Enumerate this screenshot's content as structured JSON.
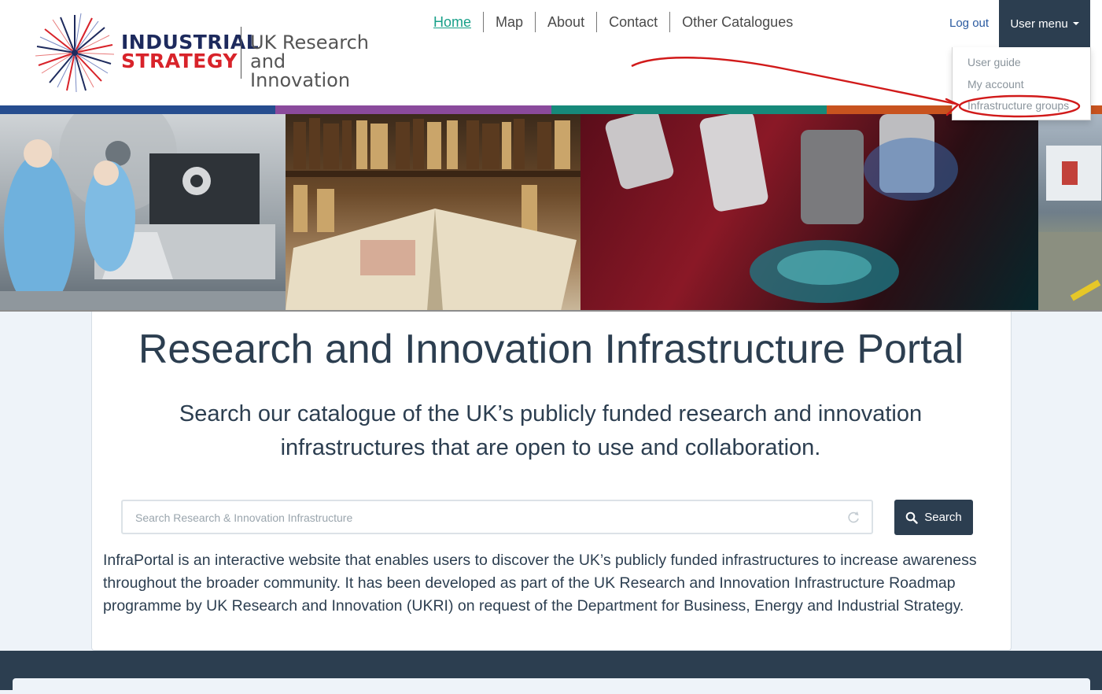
{
  "logo": {
    "line1": "INDUSTRIAL",
    "line2": "STRATEGY",
    "ukri_line1": "UK Research",
    "ukri_line2": "and Innovation"
  },
  "nav": {
    "items": [
      {
        "label": "Home"
      },
      {
        "label": "Map"
      },
      {
        "label": "About"
      },
      {
        "label": "Contact"
      },
      {
        "label": "Other Catalogues"
      }
    ],
    "logout_label": "Log out",
    "user_menu_label": "User menu"
  },
  "dropdown": {
    "items": [
      {
        "label": "User guide"
      },
      {
        "label": "My account"
      },
      {
        "label": "Infrastructure groups"
      }
    ]
  },
  "stripe_colors": [
    "#264d8f",
    "#8a4a9c",
    "#16897a",
    "#c8531f"
  ],
  "main": {
    "title": "Research and Innovation Infrastructure Portal",
    "subtitle": "Search our catalogue of the UK’s publicly funded research and innovation infrastructures that are open to use and collaboration.",
    "search_placeholder": "Search Research & Innovation Infrastructure",
    "search_value": "",
    "search_button_label": "Search",
    "description": "InfraPortal is an interactive website that enables users to discover the UK’s publicly funded infrastructures to increase awareness throughout the broader community. It has been developed as part of the UK Research and Innovation Infrastructure Roadmap programme by UK Research and Innovation (UKRI) on request of the Department for Business, Energy and Industrial Strategy."
  },
  "colors": {
    "primary_dark": "#2c3e50",
    "nav_active": "#18a089",
    "annotation_red": "#d11a1a"
  }
}
